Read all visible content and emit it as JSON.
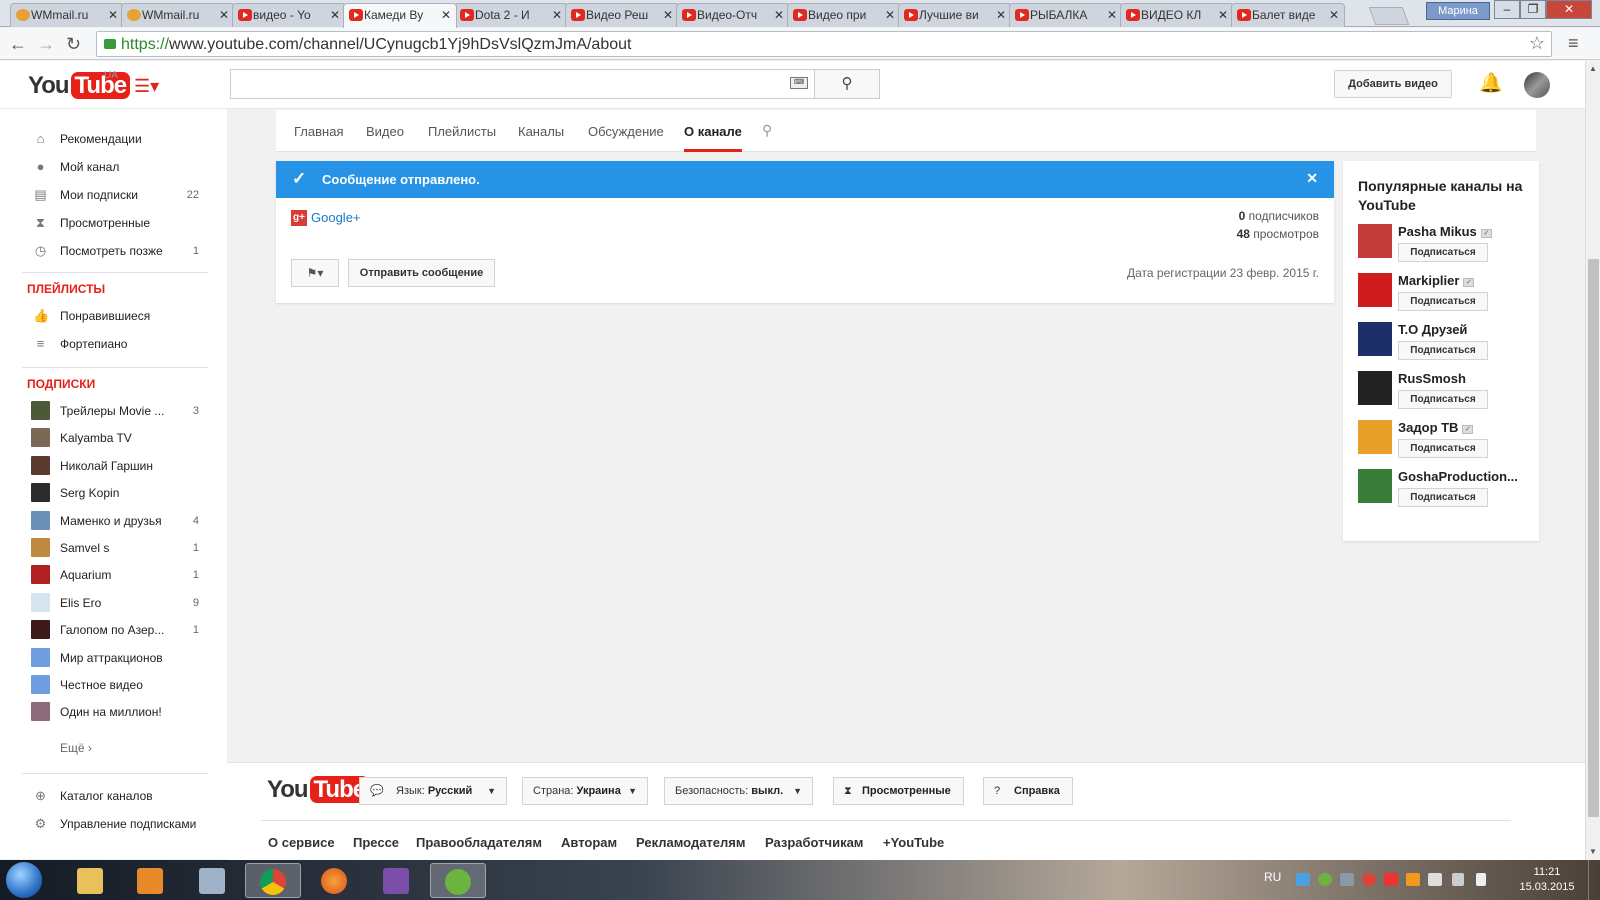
{
  "browser": {
    "tabs": [
      {
        "title": "WMmail.ru",
        "icon": "mail-icon"
      },
      {
        "title": "WMmail.ru",
        "icon": "mail-icon"
      },
      {
        "title": "видео - Yo",
        "icon": "youtube-icon"
      },
      {
        "title": "Камеди Ву",
        "icon": "youtube-icon",
        "active": true
      },
      {
        "title": "Dota 2 - И",
        "icon": "youtube-icon"
      },
      {
        "title": "Видео Реш",
        "icon": "youtube-icon"
      },
      {
        "title": "Видео-Отч",
        "icon": "youtube-icon"
      },
      {
        "title": "Видео при",
        "icon": "youtube-icon"
      },
      {
        "title": "Лучшие ви",
        "icon": "youtube-icon"
      },
      {
        "title": "РЫБАЛКА",
        "icon": "youtube-icon"
      },
      {
        "title": "ВИДЕО КЛ",
        "icon": "youtube-icon"
      },
      {
        "title": "Балет виде",
        "icon": "youtube-icon"
      }
    ],
    "window_user": "Марина",
    "url_scheme": "https://",
    "url_rest": "www.youtube.com/channel/UCynugcb1Yj9hDsVslQzmJmA/about"
  },
  "header": {
    "logo_you": "You",
    "logo_tube": "Tube",
    "region": "UA",
    "upload_label": "Добавить видео"
  },
  "guide": {
    "main": [
      {
        "label": "Рекомендации",
        "icon": "home-icon",
        "count": ""
      },
      {
        "label": "Мой канал",
        "icon": "user-icon",
        "count": ""
      },
      {
        "label": "Мои подписки",
        "icon": "subscriptions-icon",
        "count": "22"
      },
      {
        "label": "Просмотренные",
        "icon": "hourglass-icon",
        "count": ""
      },
      {
        "label": "Посмотреть позже",
        "icon": "clock-icon",
        "count": "1"
      }
    ],
    "playlists_heading": "ПЛЕЙЛИСТЫ",
    "playlists": [
      {
        "label": "Понравившиеся",
        "icon": "thumbs-up-icon"
      },
      {
        "label": "Фортепиано",
        "icon": "list-icon"
      }
    ],
    "subs_heading": "ПОДПИСКИ",
    "subscriptions": [
      {
        "label": "Трейлеры Movie ...",
        "count": "3",
        "color": "#4d5a3a"
      },
      {
        "label": "Kalyamba TV",
        "count": "",
        "color": "#7a6a55"
      },
      {
        "label": "Николай Гаршин",
        "count": "",
        "color": "#5b3a2e"
      },
      {
        "label": "Serg Kopin",
        "count": "",
        "color": "#2c2c2c"
      },
      {
        "label": "Маменко и друзья",
        "count": "4",
        "color": "#6c8fb5"
      },
      {
        "label": "Samvel s",
        "count": "1",
        "color": "#c08a3e"
      },
      {
        "label": "Aquarium",
        "count": "1",
        "color": "#b02020"
      },
      {
        "label": "Elis Ero",
        "count": "9",
        "color": "#d6e4ef"
      },
      {
        "label": "Галопом по Азер...",
        "count": "1",
        "color": "#3b1a1a"
      },
      {
        "label": "Мир аттракционов",
        "count": "",
        "color": "#6e9de0"
      },
      {
        "label": "Честное видео",
        "count": "",
        "color": "#6e9de0"
      },
      {
        "label": "Один на миллион!",
        "count": "",
        "color": "#8c6a78"
      }
    ],
    "more_label": "Ещё ›",
    "bottom": [
      {
        "label": "Каталог каналов",
        "icon": "plus-circle-icon"
      },
      {
        "label": "Управление подписками",
        "icon": "gear-icon"
      }
    ]
  },
  "channel_nav": {
    "tabs": [
      "Главная",
      "Видео",
      "Плейлисты",
      "Каналы",
      "Обсуждение",
      "О канале"
    ],
    "active_tab": "О канале"
  },
  "about": {
    "alert_text": "Сообщение отправлено.",
    "google_plus": "Google+",
    "subscribers_count": "0",
    "subscribers_label": "подписчиков",
    "views_count": "48",
    "views_label": "просмотров",
    "send_message_label": "Отправить сообщение",
    "joined": "Дата регистрации 23 февр. 2015 г."
  },
  "popular": {
    "title": "Популярные каналы на YouTube",
    "subscribe_label": "Подписаться",
    "channels": [
      {
        "name": "Pasha Mikus",
        "verified": true,
        "color": "#c23a3a"
      },
      {
        "name": "Markiplier",
        "verified": true,
        "color": "#d01c1c"
      },
      {
        "name": "Т.О Друзей",
        "verified": false,
        "color": "#1c2f66"
      },
      {
        "name": "RusSmosh",
        "verified": false,
        "color": "#222222"
      },
      {
        "name": "Задор ТВ",
        "verified": true,
        "color": "#e8a02a"
      },
      {
        "name": "GoshaProduction...",
        "verified": false,
        "color": "#3a7d3a"
      }
    ]
  },
  "footer": {
    "lang_label": "Язык:",
    "lang_value": "Русский",
    "country_label": "Страна:",
    "country_value": "Украина",
    "safety_label": "Безопасность:",
    "safety_value": "выкл.",
    "history_label": "Просмотренные",
    "help_label": "Справка",
    "links": [
      "О сервисе",
      "Прессе",
      "Правообладателям",
      "Авторам",
      "Рекламодателям",
      "Разработчикам",
      "+YouTube"
    ]
  },
  "taskbar": {
    "lang": "RU",
    "time": "11:21",
    "date": "15.03.2015"
  },
  "colors": {
    "youtube_red": "#e62117",
    "alert_blue": "#2793e6",
    "link_blue": "#167ac6"
  }
}
